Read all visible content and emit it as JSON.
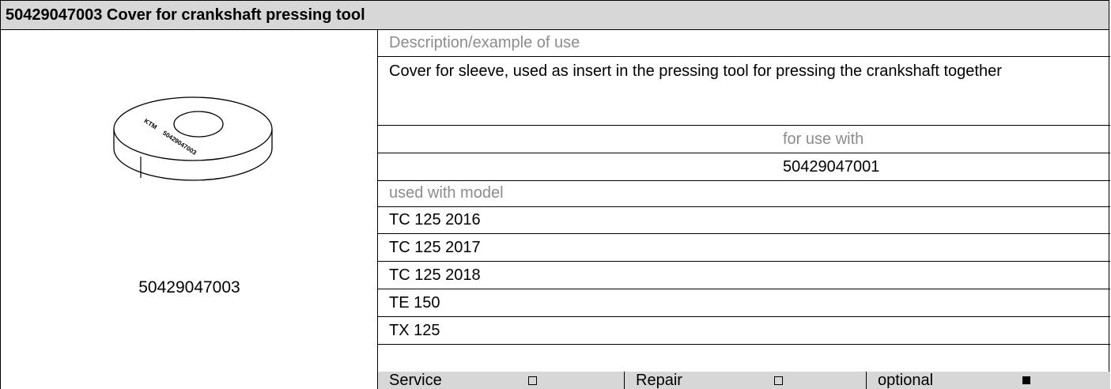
{
  "title": "50429047003 Cover for crankshaft pressing tool",
  "image_caption": "50429047003",
  "engraving": {
    "brand": "KTM",
    "number": "50429047003"
  },
  "description": {
    "label": "Description/example of use",
    "text": "Cover for sleeve, used as insert in the pressing tool for pressing the crankshaft together"
  },
  "for_use_with": {
    "label": "for use with",
    "value": "50429047001"
  },
  "models": {
    "label": "used with model",
    "items": [
      "TC 125 2016",
      "TC 125 2017",
      "TC 125 2018",
      "TE 150",
      "TX 125"
    ]
  },
  "usage": [
    {
      "label": "Service",
      "checked": false
    },
    {
      "label": "Repair",
      "checked": false
    },
    {
      "label": "optional",
      "checked": true
    }
  ],
  "colors": {
    "header_bg": "#d7d7d7",
    "label_gray": "#8c8c8c"
  }
}
